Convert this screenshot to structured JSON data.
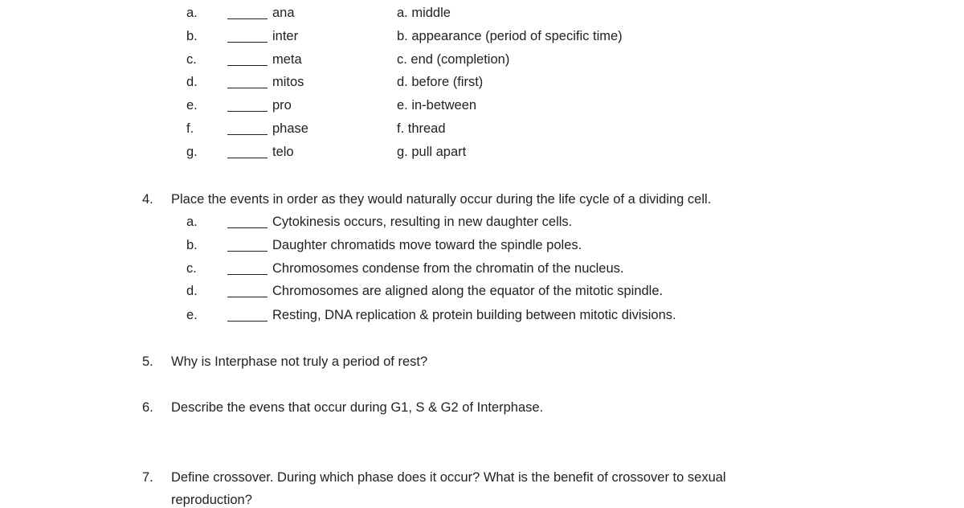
{
  "q3": {
    "terms": [
      {
        "letter": "a.",
        "term": "ana",
        "meaning": "a. middle"
      },
      {
        "letter": "b.",
        "term": "inter",
        "meaning": "b. appearance (period of specific time)"
      },
      {
        "letter": "c.",
        "term": "meta",
        "meaning": "c. end (completion)"
      },
      {
        "letter": "d.",
        "term": "mitos",
        "meaning": "d. before (first)"
      },
      {
        "letter": "e.",
        "term": "pro",
        "meaning": "e. in-between"
      },
      {
        "letter": "f.",
        "term": "phase",
        "meaning": "f. thread"
      },
      {
        "letter": "g.",
        "term": "telo",
        "meaning": "g. pull apart"
      }
    ]
  },
  "q4": {
    "number": "4.",
    "prompt": "Place the events in order as they would naturally occur during the life cycle of a dividing cell.",
    "items": [
      {
        "letter": "a.",
        "text": "Cytokinesis occurs, resulting in new daughter cells."
      },
      {
        "letter": "b.",
        "text": "Daughter chromatids move toward the spindle poles."
      },
      {
        "letter": "c.",
        "text": "Chromosomes condense from the chromatin of the nucleus."
      },
      {
        "letter": "d.",
        "text": "Chromosomes are aligned along the equator of the mitotic spindle."
      },
      {
        "letter": "e.",
        "text": "Resting, DNA replication & protein building between mitotic divisions."
      }
    ]
  },
  "q5": {
    "number": "5.",
    "prompt": "Why is Interphase not truly a period of rest?"
  },
  "q6": {
    "number": "6.",
    "prompt": "Describe the evens that occur during G1, S & G2 of Interphase."
  },
  "q7": {
    "number": "7.",
    "prompt_line1": "Define crossover. During which phase does it occur? What is the benefit of crossover to sexual",
    "prompt_line2": "reproduction?"
  }
}
